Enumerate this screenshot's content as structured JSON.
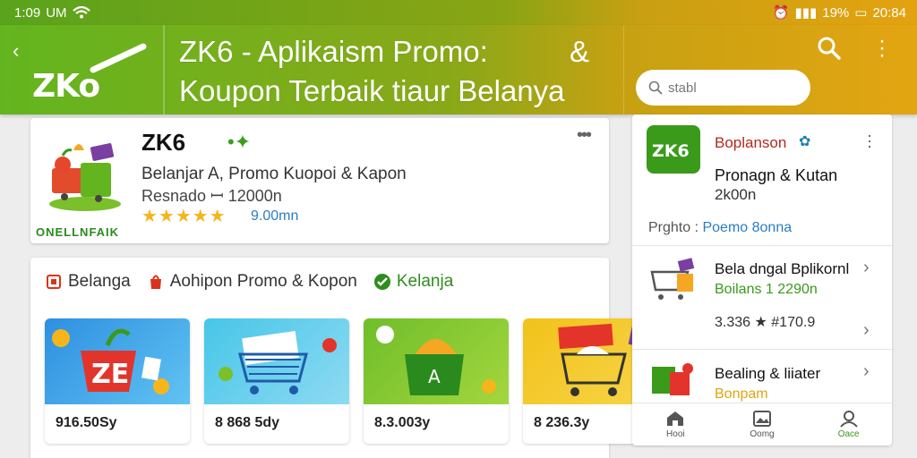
{
  "status_bar": {
    "time": "1:09",
    "left_text": "1:09 ꟷ UM",
    "right_text": "ⓓ ꟷ 19% ▭ 20:84",
    "battery": "19%",
    "clock": "20:84"
  },
  "header": {
    "logo_text": "ZKo",
    "title_line1": "ZK6 - Aplikaism Promo:",
    "title_amp": "&",
    "title_line2": "Koupon Terbaik tiaur Belanya",
    "search_placeholder": "stabl"
  },
  "app": {
    "name": "ZK6",
    "desc": "Belanjar A, Promo Kuopoi & Kapon",
    "sub": "Resnado ꟷ 12000n",
    "stars": "★★★★★",
    "rating_count": "9.00mn",
    "brand_strip": "ONELLNFAIK"
  },
  "categories": [
    {
      "label": "Belanga",
      "color": "#d9331a"
    },
    {
      "label": "Aohipon Promo & Kopon",
      "color": "#d9331a"
    },
    {
      "label": "Kelanja",
      "color": "#2f8c1f"
    }
  ],
  "tiles": [
    {
      "price": "9 16.50 Sy",
      "price_text": "916.50Sy"
    },
    {
      "price": "8 868 5dy",
      "price_text": "8 868 5dy"
    },
    {
      "price": "8.3.003y",
      "price_text": "8.3.003y"
    },
    {
      "price": "8 236.3y",
      "price_text": "8 236.3y"
    }
  ],
  "panel": {
    "icon_text": "ZK6",
    "name": "Boplanson",
    "line1": "Pronagn & Kutan",
    "line2": "2k00n",
    "pright_label": "Prghto :",
    "pright_value": "Poemo 8onna",
    "rows": [
      {
        "title": "Bela dngal Bplikornl",
        "sub": "Boilans 1 2290n",
        "sub_color": "#3a9a1a"
      },
      {
        "title": "Bealing & liiater",
        "sub": "Bonpam",
        "sub_color": "#e1a412"
      }
    ],
    "meta": "3.336 ★ #170.9",
    "nav": [
      {
        "label": "Hooi",
        "icon": "home-icon"
      },
      {
        "label": "Oomg",
        "icon": "image-icon"
      },
      {
        "label": "Oace",
        "icon": "profile-icon"
      }
    ]
  },
  "colors": {
    "brand_green": "#63b51f",
    "brand_yellow": "#e3a512",
    "link_blue": "#2a7cc7",
    "star": "#f5b51b"
  }
}
